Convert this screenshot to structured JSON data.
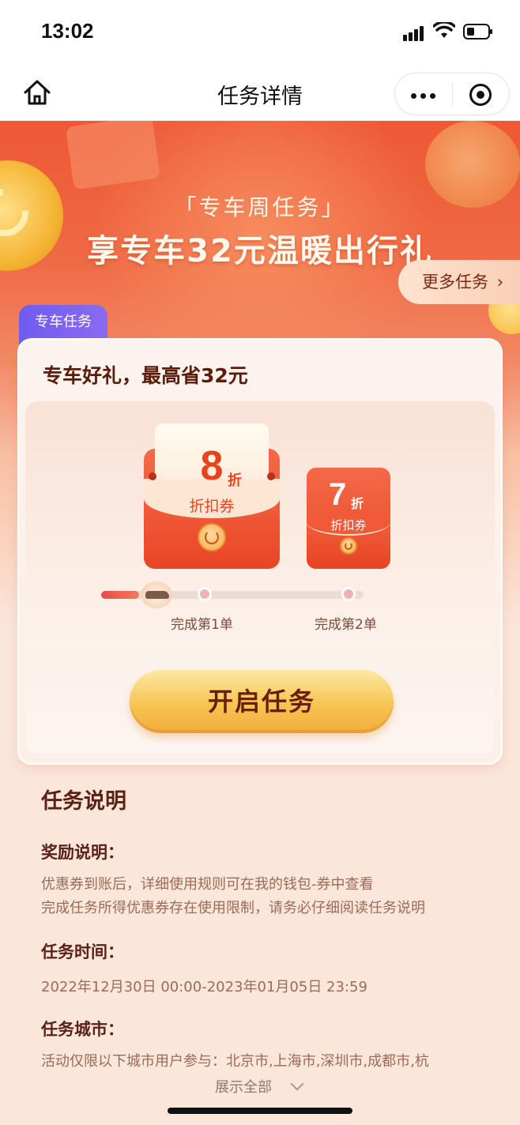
{
  "status": {
    "time": "13:02"
  },
  "nav": {
    "title": "任务详情"
  },
  "hero": {
    "subtitle": "「专车周任务」",
    "title": "享专车32元温暖出行礼",
    "more_tasks": "更多任务"
  },
  "card": {
    "tag": "专车任务",
    "title": "专车好礼，最高省32元",
    "coupons": [
      {
        "value": "8",
        "unit": "折",
        "label": "折扣券"
      },
      {
        "value": "7",
        "unit": "折",
        "label": "折扣券"
      }
    ],
    "steps": [
      "完成第1单",
      "完成第2单"
    ],
    "start_button": "开启任务"
  },
  "description": {
    "heading": "任务说明",
    "reward_heading": "奖励说明：",
    "reward_lines": [
      "优惠券到账后，详细使用规则可在我的钱包-券中查看",
      "完成任务所得优惠券存在使用限制，请务必仔细阅读任务说明"
    ],
    "time_heading": "任务时间：",
    "time_text": "2022年12月30日 00:00-2023年01月05日 23:59",
    "city_heading": "任务城市：",
    "city_text": "活动仅限以下城市用户参与：北京市,上海市,深圳市,成都市,杭",
    "show_all": "展示全部"
  }
}
